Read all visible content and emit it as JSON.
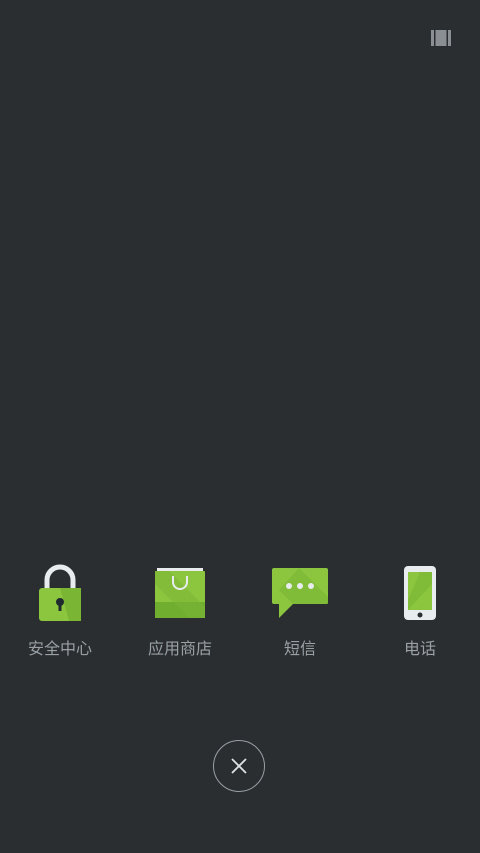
{
  "apps": [
    {
      "label": "安全中心",
      "icon": "lock-icon"
    },
    {
      "label": "应用商店",
      "icon": "shopping-bag-icon"
    },
    {
      "label": "短信",
      "icon": "message-icon"
    },
    {
      "label": "电话",
      "icon": "phone-icon"
    }
  ],
  "top_right_icon": "recents-icon",
  "close_icon": "close-icon",
  "colors": {
    "background": "#2a2e31",
    "icon_green": "#8cc63f",
    "label_gray": "#9aa0a4"
  }
}
